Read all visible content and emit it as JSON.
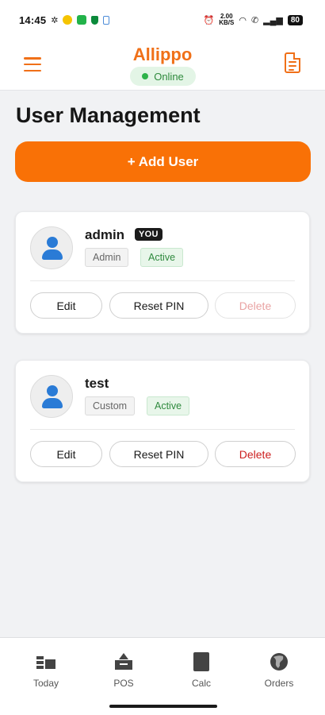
{
  "status_bar": {
    "time": "14:45",
    "speed_top": "2.00",
    "speed_bottom": "KB/S",
    "battery": "80"
  },
  "header": {
    "title": "Allippo",
    "connection_status": "Online"
  },
  "page": {
    "title": "User Management",
    "add_user_label": "+ Add User"
  },
  "users": [
    {
      "name": "admin",
      "badge": "YOU",
      "role": "Admin",
      "status": "Active",
      "edit_label": "Edit",
      "reset_label": "Reset PIN",
      "delete_label": "Delete",
      "delete_enabled": false
    },
    {
      "name": "test",
      "role": "Custom",
      "status": "Active",
      "edit_label": "Edit",
      "reset_label": "Reset PIN",
      "delete_label": "Delete",
      "delete_enabled": true
    }
  ],
  "bottom_nav": [
    {
      "label": "Today",
      "icon": "today-icon"
    },
    {
      "label": "POS",
      "icon": "pos-register-icon"
    },
    {
      "label": "Calc",
      "icon": "calculator-icon"
    },
    {
      "label": "Orders",
      "icon": "globe-icon"
    }
  ],
  "colors": {
    "accent": "#f97106",
    "online_green": "#2db34a",
    "delete_red": "#cc1f1f",
    "avatar_blue": "#2a7bd6"
  }
}
